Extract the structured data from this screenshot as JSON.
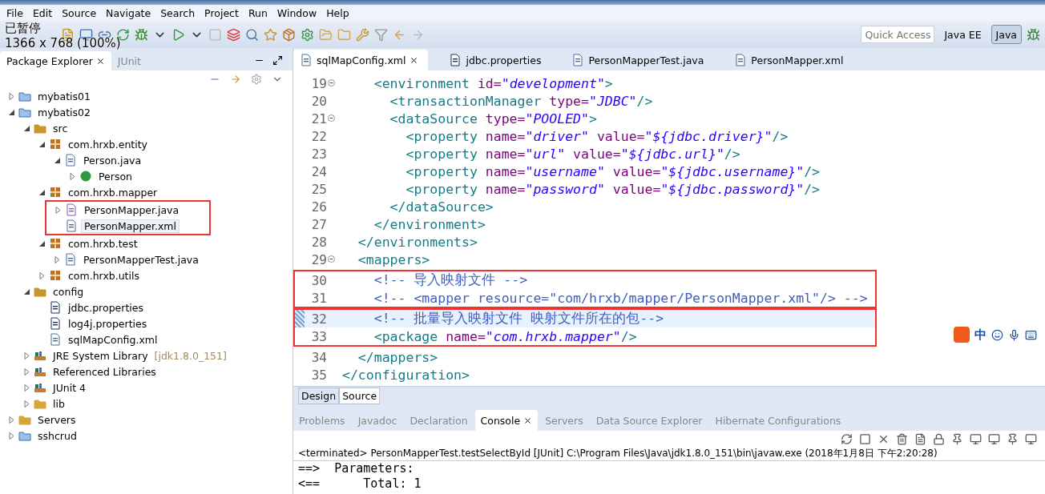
{
  "menu": [
    "File",
    "Edit",
    "Source",
    "Navigate",
    "Search",
    "Project",
    "Run",
    "Window",
    "Help"
  ],
  "recorder_overlay": {
    "status": "已暂停",
    "resolution": "1366 x 768 (100%)"
  },
  "quick_access": {
    "placeholder": "Quick Access"
  },
  "perspectives": [
    {
      "label": "Java EE",
      "selected": false
    },
    {
      "label": "Java",
      "selected": true
    }
  ],
  "explorer": {
    "tabs": [
      {
        "label": "Package Explorer",
        "selected": true
      },
      {
        "label": "JUnit",
        "selected": false
      }
    ],
    "tree": [
      {
        "label": "mybatis01",
        "kind": "project",
        "expanded": false,
        "selected": false
      },
      {
        "label": "mybatis02",
        "kind": "project",
        "expanded": true,
        "selected": false,
        "children": [
          {
            "label": "src",
            "kind": "sourcefolder",
            "expanded": true,
            "selected": false,
            "children": [
              {
                "label": "com.hrxb.entity",
                "kind": "package",
                "expanded": true,
                "selected": false,
                "children": [
                  {
                    "label": "Person.java",
                    "kind": "java",
                    "expanded": true,
                    "selected": false,
                    "children": [
                      {
                        "label": "Person",
                        "kind": "class",
                        "expanded": false,
                        "selected": false
                      }
                    ]
                  }
                ]
              },
              {
                "label": "com.hrxb.mapper",
                "kind": "package",
                "expanded": true,
                "selected": false,
                "boxed_children": true,
                "children": [
                  {
                    "label": "PersonMapper.java",
                    "kind": "interface",
                    "expanded": false,
                    "selected": false
                  },
                  {
                    "label": "PersonMapper.xml",
                    "kind": "xml",
                    "selected": true
                  }
                ]
              },
              {
                "label": "com.hrxb.test",
                "kind": "package",
                "expanded": true,
                "selected": false,
                "children": [
                  {
                    "label": "PersonMapperTest.java",
                    "kind": "java",
                    "expanded": false,
                    "selected": false
                  }
                ]
              },
              {
                "label": "com.hrxb.utils",
                "kind": "package",
                "expanded": false,
                "selected": false
              }
            ]
          },
          {
            "label": "config",
            "kind": "sourcefolder",
            "expanded": true,
            "selected": false,
            "children": [
              {
                "label": "jdbc.properties",
                "kind": "properties",
                "selected": false
              },
              {
                "label": "log4j.properties",
                "kind": "properties",
                "selected": false
              },
              {
                "label": "sqlMapConfig.xml",
                "kind": "xml",
                "selected": false
              }
            ]
          },
          {
            "label": "JRE System Library",
            "suffix": "[jdk1.8.0_151]",
            "kind": "library",
            "expanded": false,
            "selected": false
          },
          {
            "label": "Referenced Libraries",
            "kind": "library",
            "expanded": false,
            "selected": false
          },
          {
            "label": "JUnit 4",
            "kind": "library",
            "expanded": false,
            "selected": false
          },
          {
            "label": "lib",
            "kind": "folder",
            "expanded": false,
            "selected": false
          }
        ]
      },
      {
        "label": "Servers",
        "kind": "folder",
        "expanded": false,
        "selected": false
      },
      {
        "label": "sshcrud",
        "kind": "project",
        "expanded": false,
        "selected": false
      }
    ]
  },
  "editor": {
    "tabs": [
      {
        "label": "sqlMapConfig.xml",
        "kind": "xml",
        "selected": true
      },
      {
        "label": "jdbc.properties",
        "kind": "properties",
        "selected": false
      },
      {
        "label": "PersonMapperTest.java",
        "kind": "java",
        "selected": false
      },
      {
        "label": "PersonMapper.xml",
        "kind": "xml",
        "selected": false
      }
    ],
    "blocks": [
      {
        "boxed": false,
        "lines": [
          {
            "number": "19",
            "foldable": true,
            "current": false,
            "tokens": [
              {
                "kind": "tag",
                "text": "    <environment "
              },
              {
                "kind": "attr",
                "text": "id="
              },
              {
                "kind": "value",
                "text": "\"development\""
              },
              {
                "kind": "tag",
                "text": ">"
              }
            ]
          },
          {
            "number": "20",
            "foldable": false,
            "current": false,
            "tokens": [
              {
                "kind": "tag",
                "text": "      <transactionManager "
              },
              {
                "kind": "attr",
                "text": "type="
              },
              {
                "kind": "value",
                "text": "\"JDBC\""
              },
              {
                "kind": "tag",
                "text": "/>"
              }
            ]
          },
          {
            "number": "21",
            "foldable": true,
            "current": false,
            "tokens": [
              {
                "kind": "tag",
                "text": "      <dataSource "
              },
              {
                "kind": "attr",
                "text": "type="
              },
              {
                "kind": "value",
                "text": "\"POOLED\""
              },
              {
                "kind": "tag",
                "text": ">"
              }
            ]
          },
          {
            "number": "22",
            "foldable": false,
            "current": false,
            "tokens": [
              {
                "kind": "tag",
                "text": "        <property "
              },
              {
                "kind": "attr",
                "text": "name="
              },
              {
                "kind": "value",
                "text": "\"driver\""
              },
              {
                "kind": "attr",
                "text": " value="
              },
              {
                "kind": "value",
                "text": "\"${jdbc.driver}\""
              },
              {
                "kind": "tag",
                "text": "/>"
              }
            ]
          },
          {
            "number": "23",
            "foldable": false,
            "current": false,
            "tokens": [
              {
                "kind": "tag",
                "text": "        <property "
              },
              {
                "kind": "attr",
                "text": "name="
              },
              {
                "kind": "value",
                "text": "\"url\""
              },
              {
                "kind": "attr",
                "text": " value="
              },
              {
                "kind": "value",
                "text": "\"${jdbc.url}\""
              },
              {
                "kind": "tag",
                "text": "/>"
              }
            ]
          },
          {
            "number": "24",
            "foldable": false,
            "current": false,
            "tokens": [
              {
                "kind": "tag",
                "text": "        <property "
              },
              {
                "kind": "attr",
                "text": "name="
              },
              {
                "kind": "value",
                "text": "\"username\""
              },
              {
                "kind": "attr",
                "text": " value="
              },
              {
                "kind": "value",
                "text": "\"${jdbc.username}\""
              },
              {
                "kind": "tag",
                "text": "/>"
              }
            ]
          },
          {
            "number": "25",
            "foldable": false,
            "current": false,
            "tokens": [
              {
                "kind": "tag",
                "text": "        <property "
              },
              {
                "kind": "attr",
                "text": "name="
              },
              {
                "kind": "value",
                "text": "\"password\""
              },
              {
                "kind": "attr",
                "text": " value="
              },
              {
                "kind": "value",
                "text": "\"${jdbc.password}\""
              },
              {
                "kind": "tag",
                "text": "/>"
              }
            ]
          },
          {
            "number": "26",
            "foldable": false,
            "current": false,
            "tokens": [
              {
                "kind": "tag",
                "text": "      </dataSource>"
              }
            ]
          },
          {
            "number": "27",
            "foldable": false,
            "current": false,
            "tokens": [
              {
                "kind": "tag",
                "text": "    </environment>"
              }
            ]
          },
          {
            "number": "28",
            "foldable": false,
            "current": false,
            "tokens": [
              {
                "kind": "tag",
                "text": "  </environments>"
              }
            ]
          },
          {
            "number": "29",
            "foldable": true,
            "current": false,
            "tokens": [
              {
                "kind": "tag",
                "text": "  <mappers>"
              }
            ]
          }
        ]
      },
      {
        "boxed": true,
        "lines": [
          {
            "number": "30",
            "foldable": false,
            "current": false,
            "tokens": [
              {
                "kind": "comment",
                "text": "    <!-- 导入映射文件 -->"
              }
            ]
          },
          {
            "number": "31",
            "foldable": false,
            "current": false,
            "tokens": [
              {
                "kind": "comment",
                "text": "    <!-- <mapper resource=\"com/hrxb/mapper/PersonMapper.xml\"/> -->"
              }
            ]
          }
        ]
      },
      {
        "boxed": true,
        "lines": [
          {
            "number": "32",
            "foldable": false,
            "current": true,
            "tokens": [
              {
                "kind": "comment",
                "text": "    <!-- 批量导入映射文件 映射文件所在的包-->"
              }
            ]
          },
          {
            "number": "33",
            "foldable": false,
            "current": false,
            "tokens": [
              {
                "kind": "tag",
                "text": "    <package "
              },
              {
                "kind": "attr",
                "text": "name="
              },
              {
                "kind": "value",
                "text": "\"com.hrxb.mapper\""
              },
              {
                "kind": "tag",
                "text": "/>"
              }
            ]
          }
        ]
      },
      {
        "boxed": false,
        "lines": [
          {
            "number": "34",
            "foldable": false,
            "current": false,
            "tokens": [
              {
                "kind": "tag",
                "text": "  </mappers>"
              }
            ]
          },
          {
            "number": "35",
            "foldable": false,
            "current": false,
            "tokens": [
              {
                "kind": "tag",
                "text": "</configuration>"
              }
            ]
          }
        ]
      }
    ],
    "mode_tabs": [
      {
        "label": "Design",
        "selected": false
      },
      {
        "label": "Source",
        "selected": true
      }
    ]
  },
  "ime": {
    "label": "中"
  },
  "bottom": {
    "tabs": [
      {
        "label": "Problems",
        "selected": false
      },
      {
        "label": "Javadoc",
        "selected": false
      },
      {
        "label": "Declaration",
        "selected": false
      },
      {
        "label": "Console",
        "selected": true
      },
      {
        "label": "Servers",
        "selected": false
      },
      {
        "label": "Data Source Explorer",
        "selected": false
      },
      {
        "label": "Hibernate Configurations",
        "selected": false
      }
    ],
    "console_header": "<terminated> PersonMapperTest.testSelectById [JUnit] C:\\Program Files\\Java\\jdk1.8.0_151\\bin\\javaw.exe (2018年1月8日 下午2:20:28)",
    "console_lines": [
      "==>  Parameters: ",
      "<==      Total: 1"
    ]
  }
}
